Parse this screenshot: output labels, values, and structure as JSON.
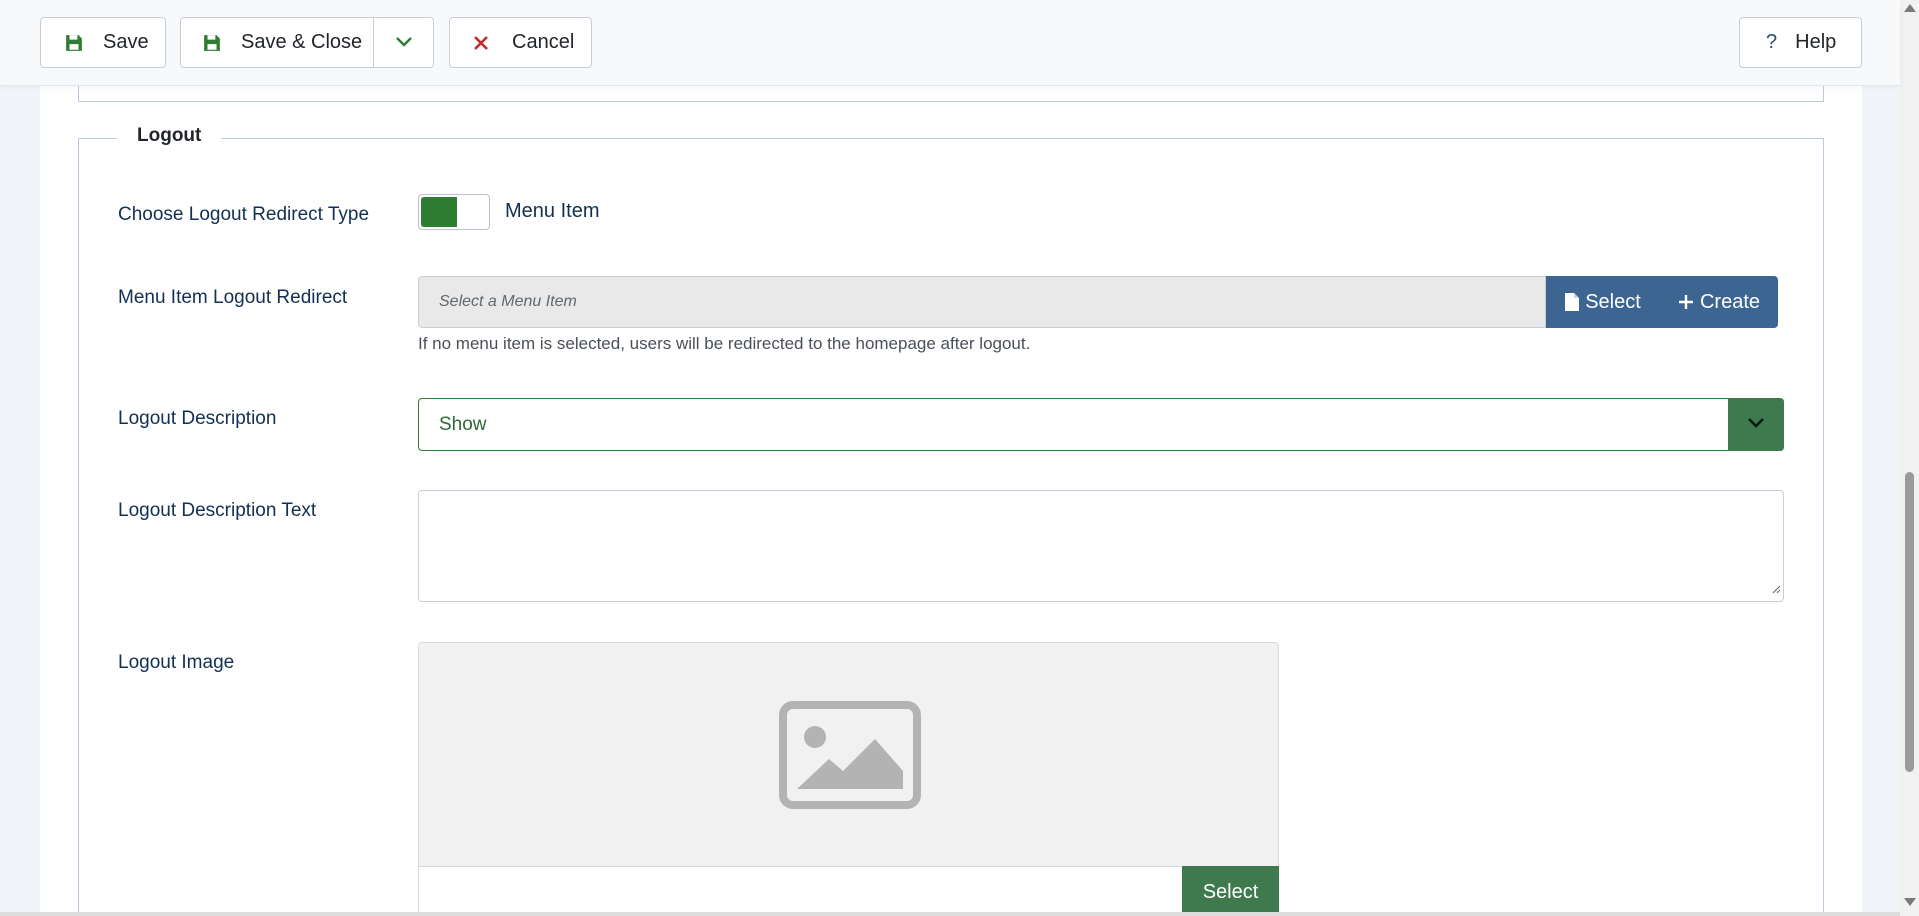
{
  "toolbar": {
    "save_label": "Save",
    "save_close_label": "Save & Close",
    "cancel_label": "Cancel",
    "help_label": "Help"
  },
  "logout_section": {
    "legend": "Logout",
    "redirect_type": {
      "label": "Choose Logout Redirect Type",
      "toggle_value": "Menu Item",
      "toggle_on": true
    },
    "menu_item_redirect": {
      "label": "Menu Item Logout Redirect",
      "placeholder": "Select a Menu Item",
      "select_label": "Select",
      "create_label": "Create",
      "help": "If no menu item is selected, users will be redirected to the homepage after logout."
    },
    "description": {
      "label": "Logout Description",
      "value": "Show"
    },
    "description_text": {
      "label": "Logout Description Text",
      "value": ""
    },
    "image": {
      "label": "Logout Image",
      "select_label": "Select"
    }
  },
  "colors": {
    "accent_green": "#2e7d32",
    "button_blue": "#3c6592",
    "label_navy": "#132f53"
  }
}
